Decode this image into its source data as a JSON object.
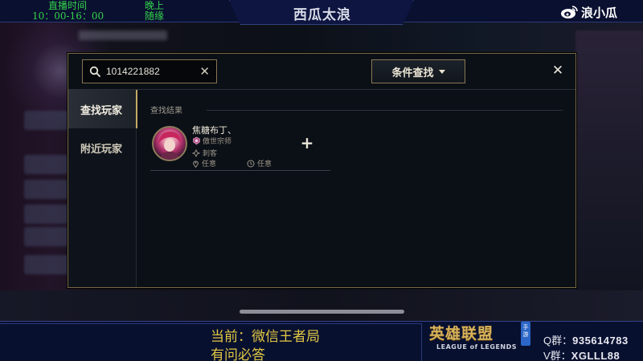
{
  "overlay": {
    "top": {
      "live_time_label": "直播时间",
      "live_time_value": "10：00-16：00",
      "evening_label": "晚上",
      "evening_value": "随缘",
      "stream_title": "西瓜太浪",
      "weibo_name": "浪小瓜"
    },
    "bottom": {
      "current_line": "当前：微信王者局",
      "ask_line": "有问必答",
      "logo_cn": "英雄联盟",
      "logo_en": "LEAGUE of LEGENDS",
      "logo_badge": "手游",
      "qq_label": "Q群：",
      "qq_value": "935614783",
      "wx_label": "V群：",
      "wx_value": "XGLLL88"
    }
  },
  "dialog": {
    "search": {
      "value": "1014221882"
    },
    "filter_button_label": "条件查找",
    "close_icon": "✕",
    "clear_icon": "✕",
    "nav": [
      {
        "label": "查找玩家",
        "active": true
      },
      {
        "label": "附近玩家",
        "active": false
      }
    ],
    "results_title": "查找结果",
    "results": [
      {
        "name": "焦糖布丁、",
        "rank": "傲世宗师",
        "role": "刺客",
        "location": "任意",
        "time": "任意",
        "add_icon": "+"
      }
    ]
  },
  "colors": {
    "gold_border": "#867552",
    "overlay_green": "#33d14a",
    "overlay_yellow": "#e2c842",
    "overlay_navy": "#0a1030"
  },
  "icons": [
    "search-icon",
    "clear-icon",
    "caret-down-icon",
    "close-icon",
    "rank-icon",
    "role-icon",
    "location-icon",
    "clock-icon",
    "add-friend-icon",
    "weibo-icon"
  ]
}
